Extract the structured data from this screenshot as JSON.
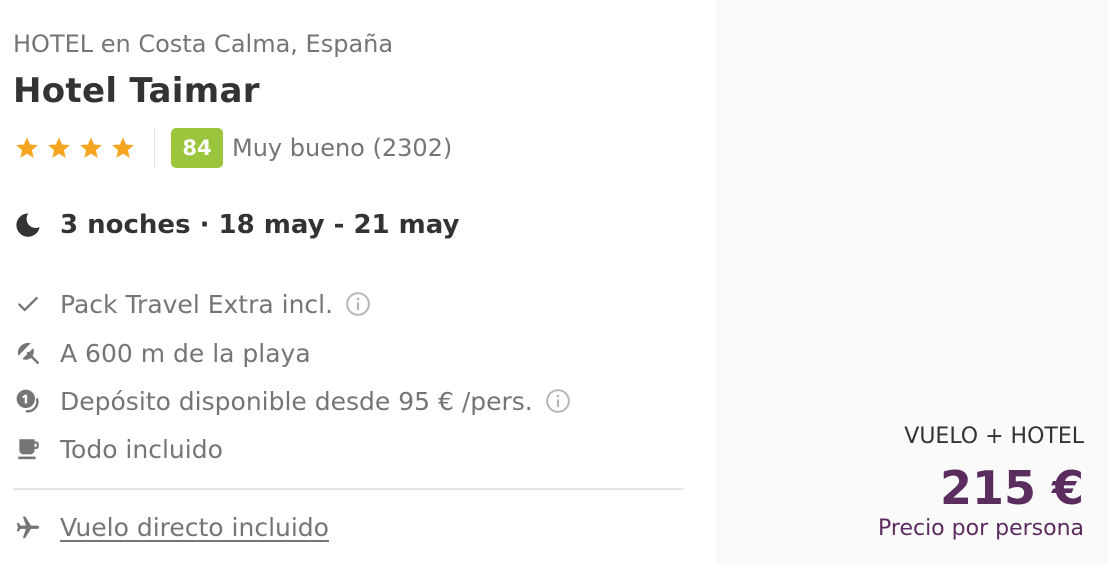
{
  "hotel": {
    "category_location": "HOTEL en Costa Calma, España",
    "name": "Hotel Taimar",
    "star_count": 4,
    "score": "84",
    "rating_text": "Muy bueno (2302)"
  },
  "stay": {
    "dates": "3 noches · 18 may - 21 may"
  },
  "features": [
    {
      "icon": "check-icon",
      "label": "Pack Travel Extra incl.",
      "has_info": true
    },
    {
      "icon": "beach-umbrella-icon",
      "label": "A 600 m de la playa",
      "has_info": false
    },
    {
      "icon": "deposit-icon",
      "label": "Depósito disponible desde 95 € /pers.",
      "has_info": true
    },
    {
      "icon": "coffee-cup-icon",
      "label": "Todo incluido",
      "has_info": false
    }
  ],
  "flight": {
    "icon": "airplane-icon",
    "label": "Vuelo directo incluido"
  },
  "pricing": {
    "package_type": "VUELO + HOTEL",
    "price": "215 €",
    "price_note": "Precio por persona"
  },
  "colors": {
    "star": "#f5a623",
    "score_badge": "#9bc53d",
    "price": "#5b2c5e",
    "muted_text": "#757575",
    "panel_bg": "#fafafa"
  }
}
